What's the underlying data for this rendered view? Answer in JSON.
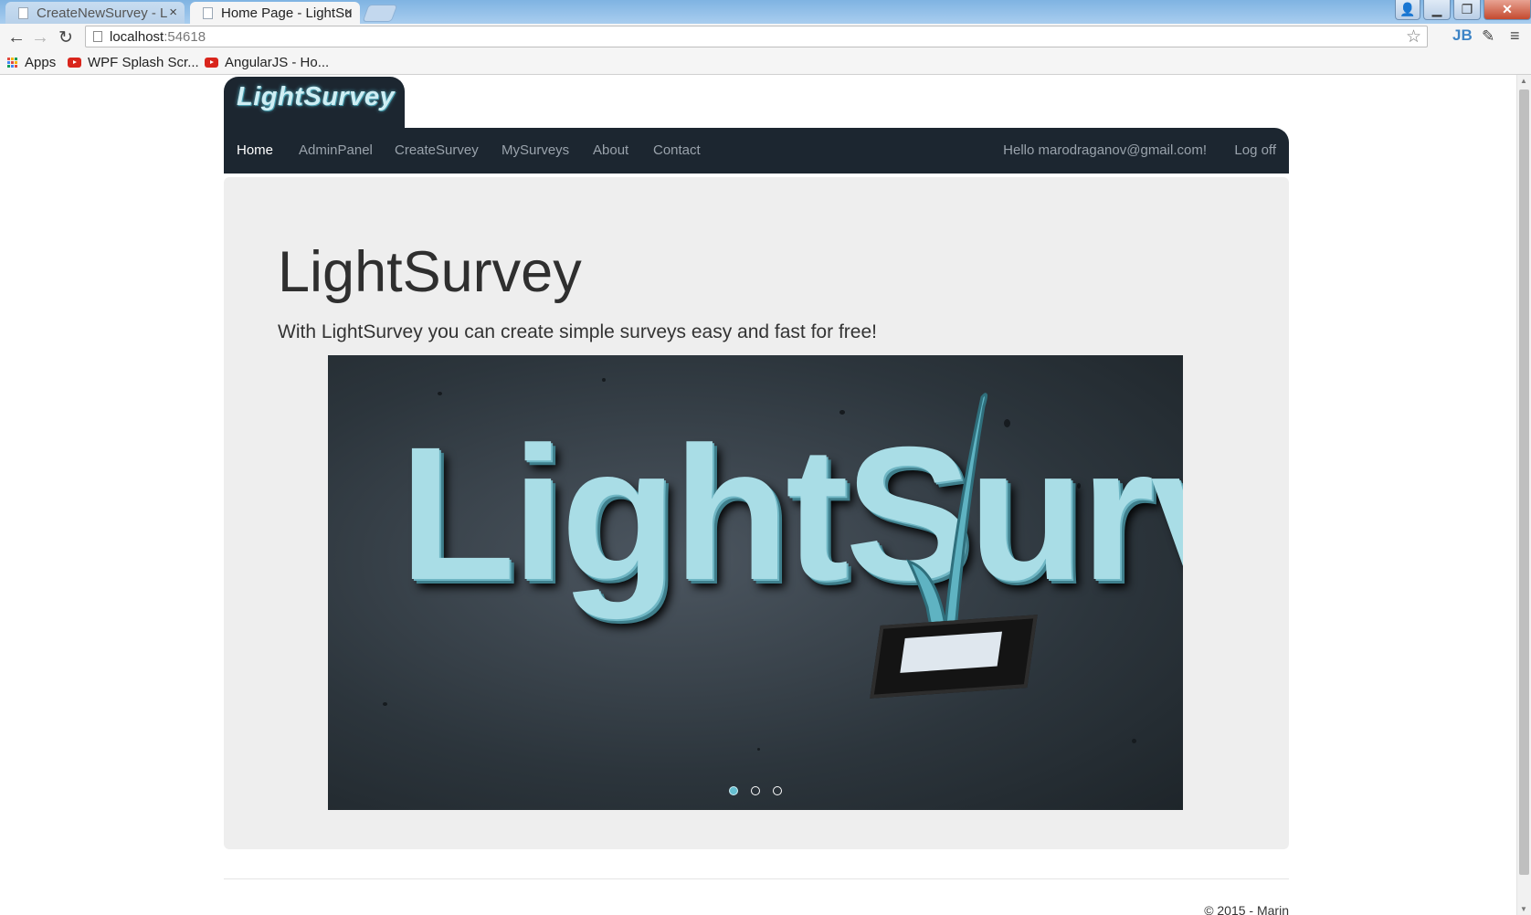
{
  "browser": {
    "tabs": [
      {
        "title": "CreateNewSurvey - L",
        "active": false
      },
      {
        "title": "Home Page - LightSu",
        "active": true
      }
    ],
    "url_host": "localhost",
    "url_port": ":54618",
    "extension_label": "JB",
    "bookmarks": [
      "Apps",
      "WPF Splash Scr...",
      "AngularJS - Ho..."
    ],
    "icons": {
      "back": "back-arrow-icon",
      "forward": "forward-arrow-icon",
      "reload": "reload-icon",
      "star": "star-icon",
      "menu": "hamburger-menu-icon"
    }
  },
  "site": {
    "brand": "LightSurvey",
    "nav": [
      {
        "label": "Home",
        "active": true
      },
      {
        "label": "AdminPanel"
      },
      {
        "label": "CreateSurvey"
      },
      {
        "label": "MySurveys"
      },
      {
        "label": "About"
      },
      {
        "label": "Contact"
      }
    ],
    "greeting": "Hello marodraganov@gmail.com!",
    "logoff": "Log off"
  },
  "jumbotron": {
    "title": "LightSurvey",
    "lead": "With LightSurvey you can create simple surveys easy and fast for free!"
  },
  "carousel": {
    "slide_text": "LightSurvey",
    "slide_count": 3,
    "active_index": 0
  },
  "footer": {
    "text": "© 2015 - Marin"
  },
  "colors": {
    "navbar": "#1c2630",
    "jumbotron": "#eeeeee",
    "accent": "#59b7c6"
  }
}
